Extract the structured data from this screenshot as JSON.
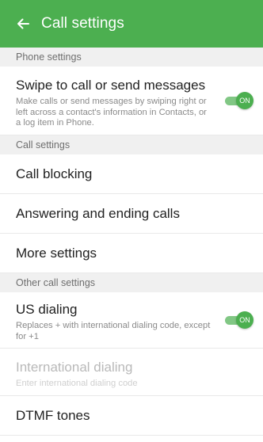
{
  "appbar": {
    "title": "Call settings",
    "back_icon": "arrow-left-icon",
    "color": "#4caf50"
  },
  "sections": {
    "phone_settings": "Phone settings",
    "call_settings": "Call settings",
    "other_call_settings": "Other call settings"
  },
  "items": {
    "swipe": {
      "title": "Swipe to call or send messages",
      "subtitle": "Make calls or send messages by swiping right or left across a contact's information in Contacts, or a log item in Phone.",
      "toggle_label": "ON",
      "enabled": true
    },
    "call_blocking": {
      "title": "Call blocking"
    },
    "answering": {
      "title": "Answering and ending calls"
    },
    "more_settings": {
      "title": "More settings"
    },
    "us_dialing": {
      "title": "US dialing",
      "subtitle": "Replaces + with international dialing code, except for +1",
      "toggle_label": "ON",
      "enabled": true
    },
    "international_dialing": {
      "title": "International dialing",
      "subtitle": "Enter international dialing code",
      "disabled": true
    },
    "dtmf_tones": {
      "title": "DTMF tones"
    }
  }
}
